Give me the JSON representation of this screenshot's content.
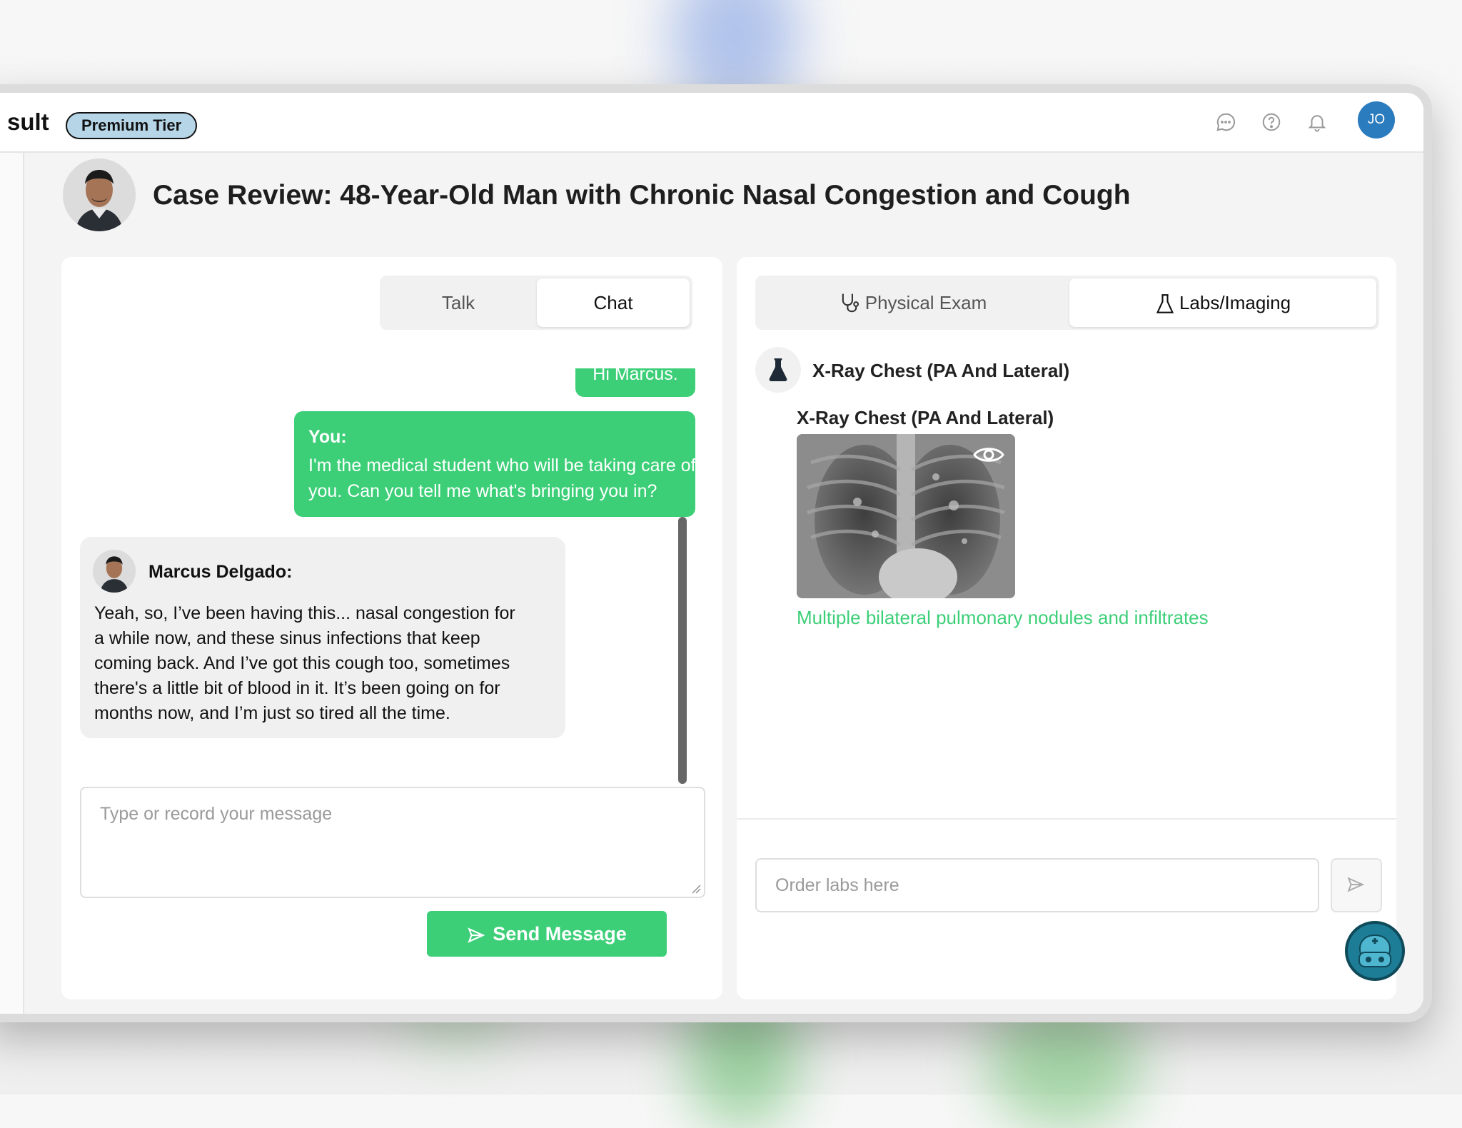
{
  "app": {
    "brand": "sult",
    "tier_badge": "Premium Tier",
    "user_initials": "JO"
  },
  "case": {
    "title": "Case Review: 48-Year-Old Man with Chronic Nasal Congestion and Cough"
  },
  "chat_panel": {
    "tabs": [
      {
        "label": "Talk",
        "active": false
      },
      {
        "label": "Chat",
        "active": true
      }
    ],
    "messages": [
      {
        "sender": "me",
        "text": "Hi Marcus."
      },
      {
        "sender": "me",
        "label": "You:",
        "text_line1": "I'm the medical student who will be taking care of",
        "text_line2": "you. Can you tell me what's bringing you in?"
      },
      {
        "sender": "patient",
        "label": "Marcus Delgado:",
        "lines": [
          "Yeah, so, I’ve been having this... nasal congestion for",
          "a while now, and these sinus infections that keep",
          "coming back. And I’ve got this cough too, sometimes",
          "there's a little bit of blood in it. It’s been going on for",
          "months now, and I’m just so tired all the time."
        ]
      }
    ],
    "input_placeholder": "Type or record your message",
    "send_label": "Send Message"
  },
  "exam_panel": {
    "tabs": [
      {
        "label": "Physical Exam",
        "icon": "stethoscope-icon",
        "active": false
      },
      {
        "label": "Labs/Imaging",
        "icon": "flask-icon",
        "active": true
      }
    ],
    "lab_result": {
      "heading": "X-Ray Chest (PA And Lateral)",
      "image_title": "X-Ray Chest (PA And Lateral)",
      "finding": "Multiple bilateral pulmonary nodules and infiltrates"
    },
    "order_placeholder": "Order labs here"
  },
  "colors": {
    "accent_green": "#3ccf78",
    "avatar_blue": "#2b7bbf",
    "tier_badge": "#b6d6e8"
  }
}
